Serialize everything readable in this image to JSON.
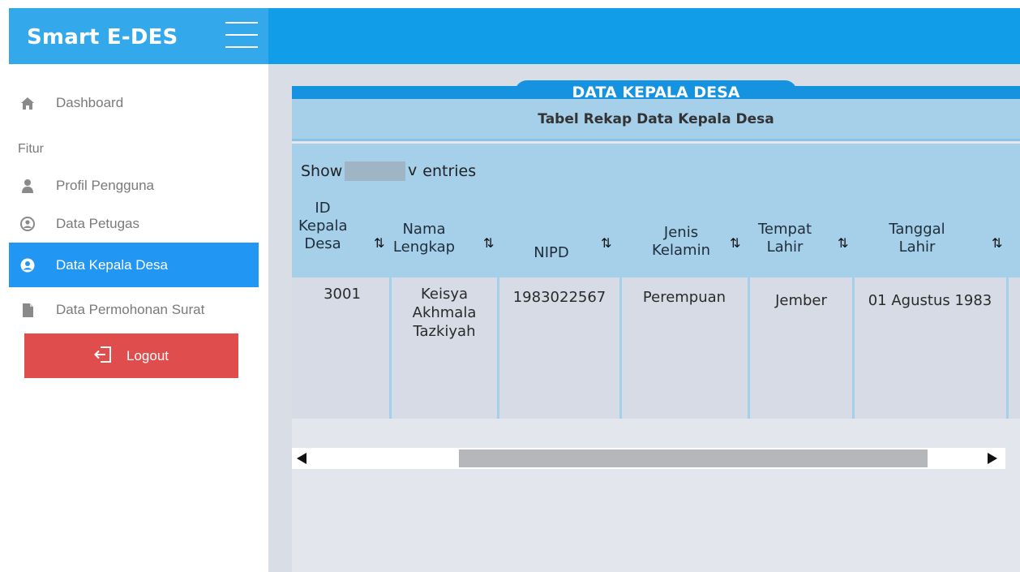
{
  "app": {
    "title": "Smart E-DES"
  },
  "sidebar": {
    "items": [
      {
        "label": "Dashboard",
        "icon": "home-icon"
      },
      {
        "label": "Profil Pengguna",
        "icon": "user-icon"
      },
      {
        "label": "Data  Petugas",
        "icon": "staff-icon"
      },
      {
        "label": "Data  Kepala Desa",
        "icon": "user-circle-icon",
        "active": true
      },
      {
        "label": "Data Permohonan Surat",
        "icon": "file-icon"
      }
    ],
    "section_label": "Fitur",
    "logout_label": "Logout"
  },
  "panel": {
    "title": "DATA KEPALA DESA",
    "subtitle": "Tabel Rekap Data Kepala Desa",
    "show_prefix": "Show",
    "show_value": "",
    "show_caret": "v",
    "show_suffix": "entries"
  },
  "table": {
    "columns": [
      {
        "key": "id",
        "label": "ID Kepala Desa"
      },
      {
        "key": "nama",
        "label": "Nama Lengkap"
      },
      {
        "key": "nipd",
        "label": "NIPD"
      },
      {
        "key": "jk",
        "label": "Jenis Kelamin"
      },
      {
        "key": "tempat",
        "label": "Tempat Lahir"
      },
      {
        "key": "tanggal",
        "label": "Tanggal Lahir"
      }
    ],
    "header_lines": {
      "id": [
        "ID",
        "Kepala",
        "Desa"
      ],
      "nama": [
        "Nama",
        "Lengkap"
      ],
      "nipd": [
        "NIPD"
      ],
      "jk": [
        "Jenis",
        "Kelamin"
      ],
      "tempat": [
        "Tempat",
        "Lahir"
      ],
      "tanggal": [
        "Tanggal",
        "Lahir"
      ]
    },
    "sort_icon": "⇅",
    "rows": [
      {
        "id": "3001",
        "nama_lines": [
          "Keisya",
          "Akhmala",
          "Tazkiyah"
        ],
        "nipd": "1983022567",
        "jk": "Perempuan",
        "tempat": "Jember",
        "tanggal": "01 Agustus 1983"
      }
    ]
  },
  "colors": {
    "topbar": "#129de8",
    "brand_bg": "#33a9eb",
    "active_nav": "#2196f3",
    "logout": "#e04d4d",
    "table_header": "#a6cfea"
  }
}
